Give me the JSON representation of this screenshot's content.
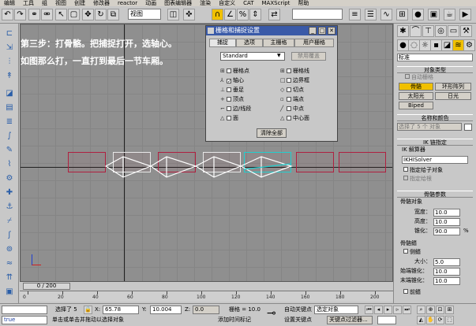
{
  "menu": [
    "编辑",
    "工具",
    "组",
    "视图",
    "创建",
    "修改器",
    "reactor",
    "动画",
    "图表编辑器",
    "渲染",
    "自定义",
    "CAT",
    "MAXScript",
    "帮助"
  ],
  "toolbar": {
    "view_combo": "视图",
    "accent": "#f0c000"
  },
  "viewport": {
    "instructions": [
      "第三步：打骨骼。把捕捉打开，选轴心。",
      "如图那么打，一直打到最后一节车厢。"
    ],
    "bone_color": "#b02040",
    "background": "#8f8f8f"
  },
  "snap_dialog": {
    "title": "栅格和捕捉设置",
    "tabs": [
      "捕捉",
      "选项",
      "主栅格",
      "用户栅格"
    ],
    "preset": "Standard",
    "override_button": "禁用覆盖",
    "options": [
      {
        "glyph": "⊞",
        "label": "栅格点",
        "checked": false
      },
      {
        "glyph": "⊞",
        "label": "栅格线",
        "checked": false
      },
      {
        "glyph": "⅄",
        "label": "轴心",
        "checked": true
      },
      {
        "glyph": "□",
        "label": "边界框",
        "checked": false
      },
      {
        "glyph": "⊥",
        "label": "垂足",
        "checked": false
      },
      {
        "glyph": "◇",
        "label": "切点",
        "checked": false
      },
      {
        "glyph": "+",
        "label": "顶点",
        "checked": false
      },
      {
        "glyph": "▫",
        "label": "端点",
        "checked": false
      },
      {
        "glyph": "⌐",
        "label": "边/线段",
        "checked": false
      },
      {
        "glyph": "╱",
        "label": "中点",
        "checked": false
      },
      {
        "glyph": "△",
        "label": "面",
        "checked": false
      },
      {
        "glyph": "△",
        "label": "中心面",
        "checked": false
      }
    ],
    "clear_all": "清除全部"
  },
  "command_panel": {
    "dropdown": "标准",
    "object_type_head": "对象类型",
    "autogrid": "自动栅格",
    "buttons": [
      [
        "骨骼",
        "环形阵列"
      ],
      [
        "太阳光",
        "日光"
      ],
      [
        "Biped",
        ""
      ]
    ],
    "name_color_head": "名称和颜色",
    "name_field": "选择了 5 个 对象",
    "ik_head": "IK 链指定",
    "ik_solver_label": "IK 解算器",
    "ik_solver": "IKHISolver",
    "assign_children": "指定给子对象",
    "assign_root": "指定给根",
    "bone_params_head": "骨骼参数",
    "bone_object_label": "骨骼对象",
    "width_label": "宽度：",
    "width_value": "10.0",
    "height_label": "高度：",
    "height_value": "10.0",
    "taper_label": "锥化：",
    "taper_value": "90.0",
    "taper_unit": "%",
    "fins_label": "骨骼鳍",
    "side_fins": "侧鳍",
    "size_label": "大小：",
    "size_value": "5.0",
    "start_taper_label": "始端锥化：",
    "start_taper_value": "10.0",
    "end_taper_label": "末端锥化：",
    "end_taper_value": "10.0",
    "front_fin": "前鳍"
  },
  "timeline": {
    "frame_display": "0 / 200",
    "ticks": [
      "0",
      "20",
      "40",
      "60",
      "80",
      "100",
      "120",
      "140",
      "160",
      "180",
      "200"
    ]
  },
  "status": {
    "selected": "选择了 5",
    "x_label": "X:",
    "x_value": "65.78",
    "y_label": "Y:",
    "y_value": "10.004",
    "z_label": "Z:",
    "z_value": "0.0",
    "grid_label": "栅格 = 10.0",
    "autokey_label": "自动关键点",
    "autokey_value": "选定对象",
    "setkey_label": "设置关键点",
    "key_filter": "关键点过滤器...",
    "prompt": "单击或单击并拖动以选择对象",
    "add_time_tag": "添加时间标记",
    "script_value": "true"
  }
}
